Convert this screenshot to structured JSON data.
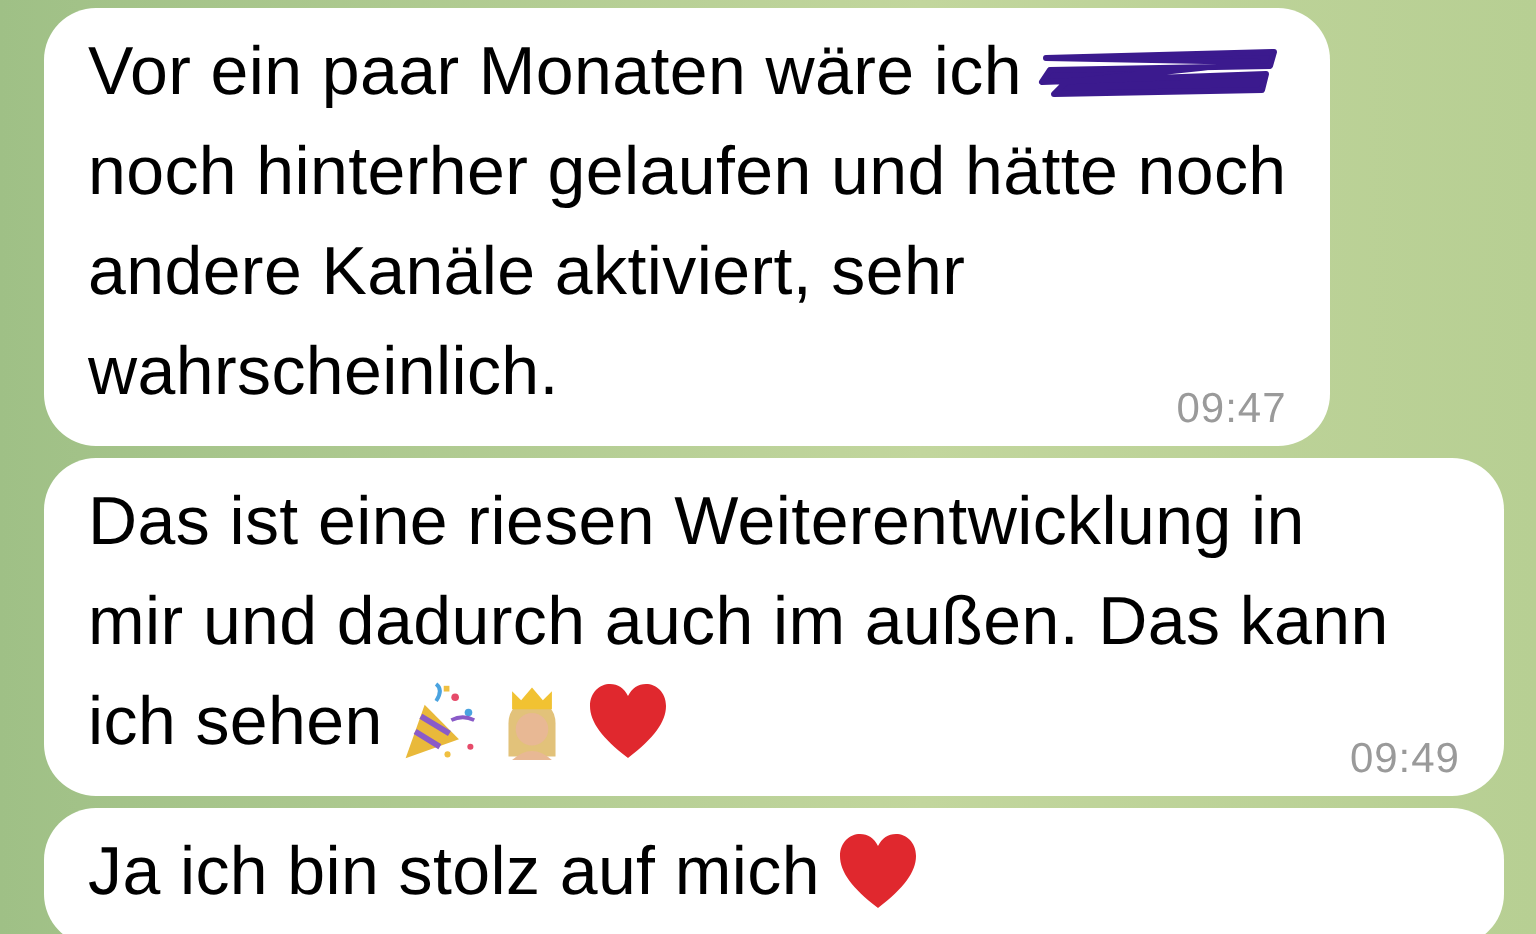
{
  "messages": [
    {
      "lines": [
        {
          "text": "Vor ein paar Monaten wäre ich",
          "redacted": true
        },
        {
          "text": "noch hinterher gelaufen und hätte noch"
        },
        {
          "text": "andere Kanäle aktiviert, sehr"
        },
        {
          "text": "wahrscheinlich."
        }
      ],
      "time": "09:47"
    },
    {
      "lines": [
        {
          "text": "Das ist eine riesen Weiterentwicklung in"
        },
        {
          "text": "mir und dadurch auch im außen. Das kann"
        },
        {
          "text": "ich sehen",
          "icons": [
            {
              "kind": "party-popper"
            },
            {
              "kind": "crowned-figure"
            },
            {
              "kind": "heart"
            }
          ]
        }
      ],
      "time": "09:49"
    },
    {
      "lines": [
        {
          "text": "Ja ich bin stolz auf mich",
          "icons": [
            {
              "kind": "heart"
            }
          ]
        }
      ]
    }
  ]
}
